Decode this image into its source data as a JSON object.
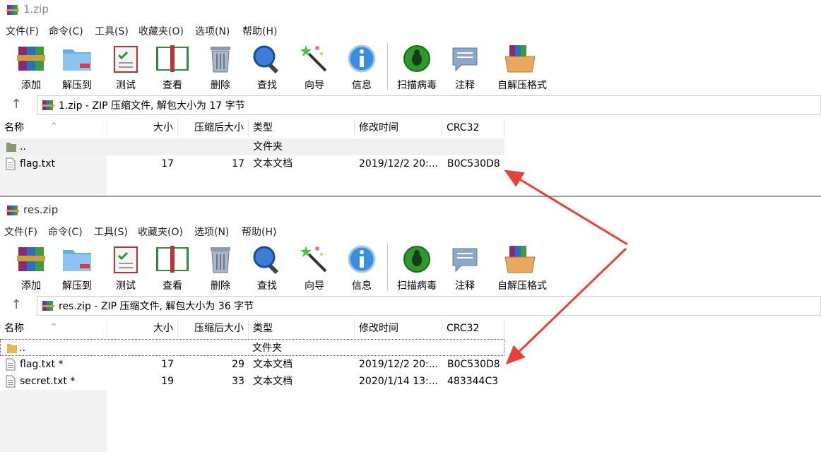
{
  "windows": [
    {
      "title": "1.zip",
      "menu": [
        "文件(F)",
        "命令(C)",
        "工具(S)",
        "收藏夹(O)",
        "选项(N)",
        "帮助(H)"
      ],
      "toolbar": [
        "添加",
        "解压到",
        "测试",
        "查看",
        "删除",
        "查找",
        "向导",
        "信息",
        "扫描病毒",
        "注释",
        "自解压格式"
      ],
      "address": "1.zip - ZIP 压缩文件, 解包大小为 17 字节",
      "headers": [
        "名称",
        "大小",
        "压缩后大小",
        "类型",
        "修改时间",
        "CRC32"
      ],
      "rows": [
        {
          "name": "..",
          "size": "",
          "packed": "",
          "type": "文件夹",
          "modified": "",
          "crc": ""
        },
        {
          "name": "flag.txt",
          "size": "17",
          "packed": "17",
          "type": "文本文档",
          "modified": "2019/12/2 20:...",
          "crc": "B0C530D8"
        }
      ]
    },
    {
      "title": "res.zip",
      "menu": [
        "文件(F)",
        "命令(C)",
        "工具(S)",
        "收藏夹(O)",
        "选项(N)",
        "帮助(H)"
      ],
      "toolbar": [
        "添加",
        "解压到",
        "测试",
        "查看",
        "删除",
        "查找",
        "向导",
        "信息",
        "扫描病毒",
        "注释",
        "自解压格式"
      ],
      "address": "res.zip - ZIP 压缩文件, 解包大小为 36 字节",
      "headers": [
        "名称",
        "大小",
        "压缩后大小",
        "类型",
        "修改时间",
        "CRC32"
      ],
      "rows": [
        {
          "name": "..",
          "size": "",
          "packed": "",
          "type": "文件夹",
          "modified": "",
          "crc": ""
        },
        {
          "name": "flag.txt *",
          "size": "17",
          "packed": "29",
          "type": "文本文档",
          "modified": "2019/12/2 20:...",
          "crc": "B0C530D8"
        },
        {
          "name": "secret.txt *",
          "size": "19",
          "packed": "33",
          "type": "文本文档",
          "modified": "2020/1/14 13:...",
          "crc": "483344C3"
        }
      ]
    }
  ],
  "colors": {
    "arrow": "#e8403a",
    "header_up_row": "#f0f0f0"
  }
}
